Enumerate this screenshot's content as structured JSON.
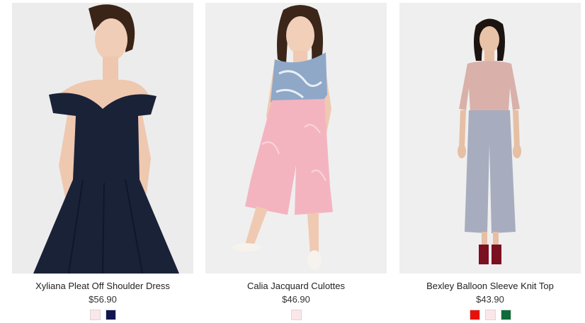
{
  "products": [
    {
      "name": "Xyliana Pleat Off Shoulder Dress",
      "price": "$56.90",
      "swatches": [
        {
          "name": "blush",
          "color": "#fbe7ea"
        },
        {
          "name": "navy",
          "color": "#101450"
        }
      ]
    },
    {
      "name": "Calia Jacquard Culottes",
      "price": "$46.90",
      "swatches": [
        {
          "name": "blush",
          "color": "#fbe7ea"
        }
      ]
    },
    {
      "name": "Bexley Balloon Sleeve Knit Top",
      "price": "$43.90",
      "swatches": [
        {
          "name": "red",
          "color": "#e8100c"
        },
        {
          "name": "blush",
          "color": "#fbe7ea"
        },
        {
          "name": "green",
          "color": "#0f6b3a"
        }
      ]
    }
  ]
}
